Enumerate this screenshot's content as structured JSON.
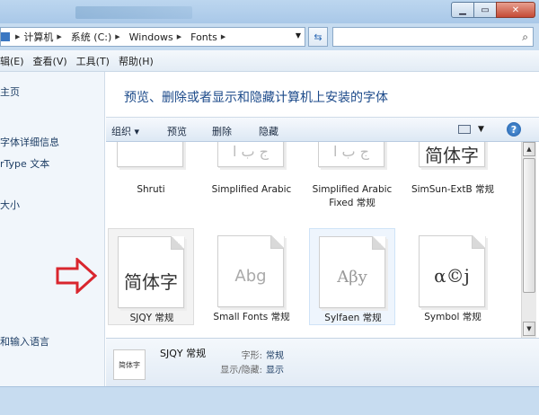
{
  "address": {
    "crumbs": [
      "计算机",
      "系统 (C:)",
      "Windows",
      "Fonts"
    ],
    "search_placeholder": ""
  },
  "menu": {
    "items": [
      "辑(E)",
      "查看(V)",
      "工具(T)",
      "帮助(H)"
    ]
  },
  "nav": {
    "links": [
      "主页",
      "字体详细信息",
      "rType 文本",
      "大小",
      "和输入语言"
    ]
  },
  "content": {
    "title": "预览、删除或者显示和隐藏计算机上安装的字体"
  },
  "commands": {
    "organize": "组织 ▾",
    "preview": "预览",
    "delete": "删除",
    "hide": "隐藏"
  },
  "fonts": {
    "row1": [
      {
        "name": "Shruti",
        "preview": ""
      },
      {
        "name": "Simplified Arabic",
        "preview": "ﺝ ﺏ ﺍ"
      },
      {
        "name": "Simplified Arabic Fixed 常规",
        "preview": "ﺝ ﺏ ﺍ"
      },
      {
        "name": "SimSun-ExtB 常规",
        "preview": "简体字"
      }
    ],
    "row2": [
      {
        "name": "SJQY 常规",
        "preview": "简体字"
      },
      {
        "name": "Small Fonts 常规",
        "preview": "Abg"
      },
      {
        "name": "Sylfaen 常规",
        "preview": "Aβy"
      },
      {
        "name": "Symbol 常规",
        "preview": "α©ϳ"
      }
    ]
  },
  "details": {
    "name": "SJQY 常规",
    "thumb_text": "简体字",
    "style_label": "字形:",
    "style_value": "常规",
    "visibility_label": "显示/隐藏:",
    "visibility_value": "显示"
  },
  "colors": {
    "arrow": "#d9262e",
    "title": "#1c4a8a",
    "nav_link": "#1f3f66"
  }
}
